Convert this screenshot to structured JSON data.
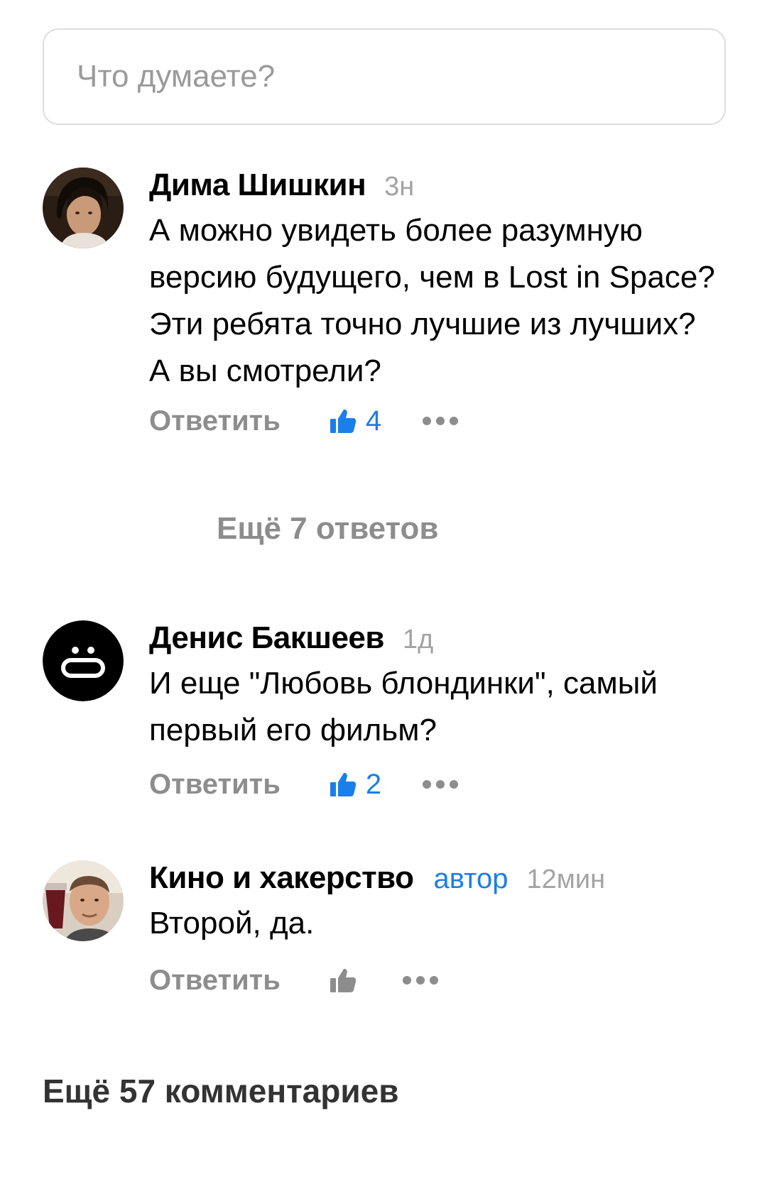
{
  "composer": {
    "placeholder": "Что думаете?"
  },
  "comments": [
    {
      "author": "Дима Шишкин",
      "time": "3н",
      "text": "А можно увидеть более разумную версию будущего, чем в Lost in Space? Эти ребята точно лучшие из лучших? А вы смотрели?",
      "reply_label": "Ответить",
      "likes": "4",
      "like_color": "#1a7fe8",
      "avatar": "user-photo-avatar"
    },
    {
      "author": "Денис Бакшеев",
      "time": "1д",
      "text": "И еще \"Любовь блондинки\", самый первый его фильм?",
      "reply_label": "Ответить",
      "likes": "2",
      "like_color": "#1a7fe8",
      "avatar": "default-face-avatar"
    },
    {
      "author": "Кино и хакерство",
      "badge": "автор",
      "time": "12мин",
      "text": "Второй, да.",
      "reply_label": "Ответить",
      "likes": "",
      "like_color": "#8d8d8d",
      "avatar": "user-photo-avatar"
    }
  ],
  "more_replies_label": "Ещё 7 ответов",
  "more_comments_label": "Ещё 57 комментариев",
  "colors": {
    "accent": "#1a7fe8",
    "muted": "#8d8d8d",
    "time": "#a3a3a3"
  }
}
